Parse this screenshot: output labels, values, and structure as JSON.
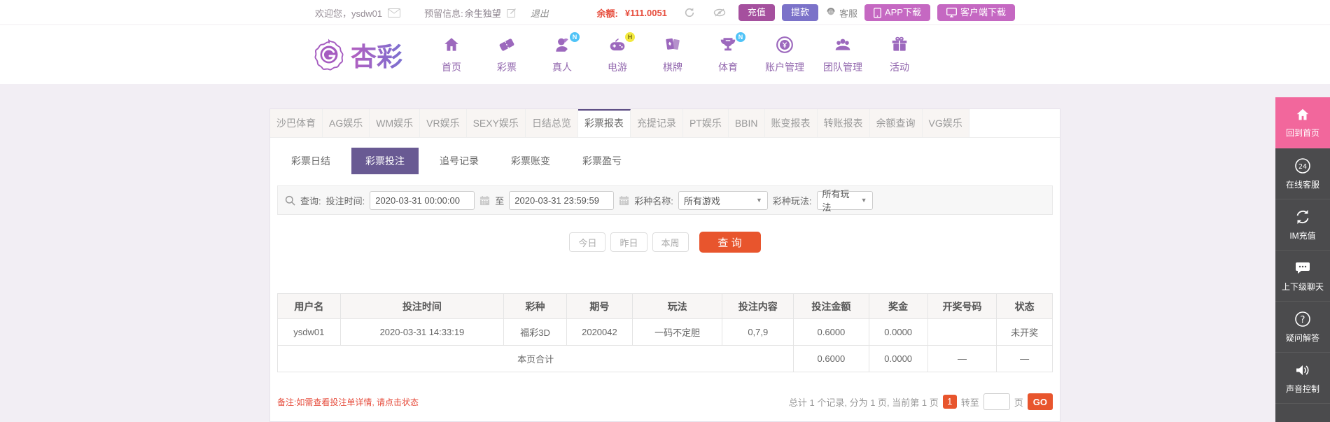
{
  "topbar": {
    "welcome": "欢迎您，ysdw01",
    "reserved_label": "预留信息:",
    "reserved_value": "余生独望",
    "logout": "退出",
    "balance_label": "余额:",
    "balance_value": "¥111.0051",
    "recharge": "充值",
    "withdraw": "提款",
    "service": "客服",
    "app_download": "APP下载",
    "client_download": "客户端下载"
  },
  "header": {
    "logo_text": "杏彩",
    "nav": [
      {
        "label": "首页",
        "badge": ""
      },
      {
        "label": "彩票",
        "badge": ""
      },
      {
        "label": "真人",
        "badge": "N"
      },
      {
        "label": "电游",
        "badge": "H"
      },
      {
        "label": "棋牌",
        "badge": ""
      },
      {
        "label": "体育",
        "badge": "N"
      },
      {
        "label": "账户管理",
        "badge": ""
      },
      {
        "label": "团队管理",
        "badge": ""
      },
      {
        "label": "活动",
        "badge": ""
      }
    ]
  },
  "tabs": {
    "active": "彩票报表",
    "items": [
      "沙巴体育",
      "AG娱乐",
      "WM娱乐",
      "VR娱乐",
      "SEXY娱乐",
      "日结总览",
      "彩票报表",
      "充提记录",
      "PT娱乐",
      "BBIN",
      "账变报表",
      "转账报表",
      "余额查询",
      "VG娱乐"
    ]
  },
  "subtabs": {
    "active": "彩票投注",
    "items": [
      "彩票日结",
      "彩票投注",
      "追号记录",
      "彩票账变",
      "彩票盈亏"
    ]
  },
  "filters": {
    "query_label": "查询:",
    "time_label": "投注时间:",
    "time_from": "2020-03-31 00:00:00",
    "to_label": "至",
    "time_to": "2020-03-31 23:59:59",
    "game_label": "彩种名称:",
    "game_value": "所有游戏",
    "play_label": "彩种玩法:",
    "play_value": "所有玩法",
    "today": "今日",
    "yesterday": "昨日",
    "week": "本周",
    "search": "查 询"
  },
  "table": {
    "headers": [
      "用户名",
      "投注时间",
      "彩种",
      "期号",
      "玩法",
      "投注内容",
      "投注金额",
      "奖金",
      "开奖号码",
      "状态"
    ],
    "rows": [
      [
        "ysdw01",
        "2020-03-31 14:33:19",
        "福彩3D",
        "2020042",
        "一码不定胆",
        "0,7,9",
        "0.6000",
        "0.0000",
        "",
        "未开奖"
      ]
    ],
    "summary": {
      "label": "本页合计",
      "bet_total": "0.6000",
      "prize_total": "0.0000",
      "draw": "—",
      "status": "—"
    }
  },
  "footer": {
    "note": "备注:如需查看投注单详情, 请点击状态",
    "pagination_text": "总计 1 个记录, 分为 1 页, 当前第 1 页",
    "page_badge": "1",
    "goto_label": "转至",
    "page_label": "页",
    "go": "GO"
  },
  "sidebar": {
    "items": [
      "回到首页",
      "在线客服",
      "IM充值",
      "上下级聊天",
      "疑问解答",
      "声音控制"
    ]
  },
  "colors": {
    "accent_purple": "#695a93",
    "brand_purple": "#9166ad",
    "tab_active_border": "#5a4a82",
    "orange": "#e8552d",
    "red": "#e64c3c",
    "green": "#2fa455",
    "sidebar_pink": "#f2679c",
    "recharge_btn": "#a5509e",
    "withdraw_btn": "#7b72c9",
    "download_btn": "#c568c2",
    "badge_blue": "#4fc3f7",
    "badge_yellow": "#f2e93e"
  }
}
